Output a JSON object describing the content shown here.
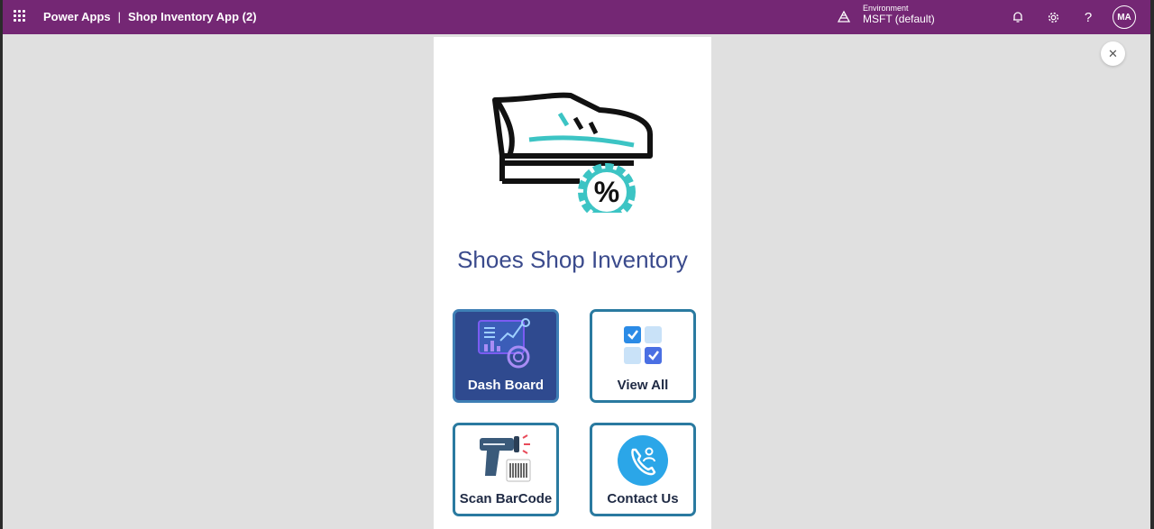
{
  "topbar": {
    "brand": "Power Apps",
    "separator": "|",
    "app_name": "Shop Inventory App (2)",
    "environment_label": "Environment",
    "environment_value": "MSFT (default)",
    "help_glyph": "?",
    "avatar_initials": "MA",
    "bg_color": "#742774"
  },
  "canvas": {
    "close_glyph": "✕",
    "bg_color": "#e0e0e0"
  },
  "app": {
    "title": "Shoes Shop Inventory",
    "hero_icon": "shoe-discount-icon",
    "badge_text": "%",
    "tiles": [
      {
        "label": "Dash Board",
        "icon": "dashboard-icon"
      },
      {
        "label": "View All",
        "icon": "view-all-icon"
      },
      {
        "label": "Scan BarCode",
        "icon": "barcode-scanner-icon"
      },
      {
        "label": "Contact Us",
        "icon": "contact-icon"
      }
    ],
    "colors": {
      "heading": "#3a4a8c",
      "tile_border": "#2a7aa0",
      "dark_tile": "#2f4a8f",
      "accent": "#3cc4c4"
    }
  }
}
